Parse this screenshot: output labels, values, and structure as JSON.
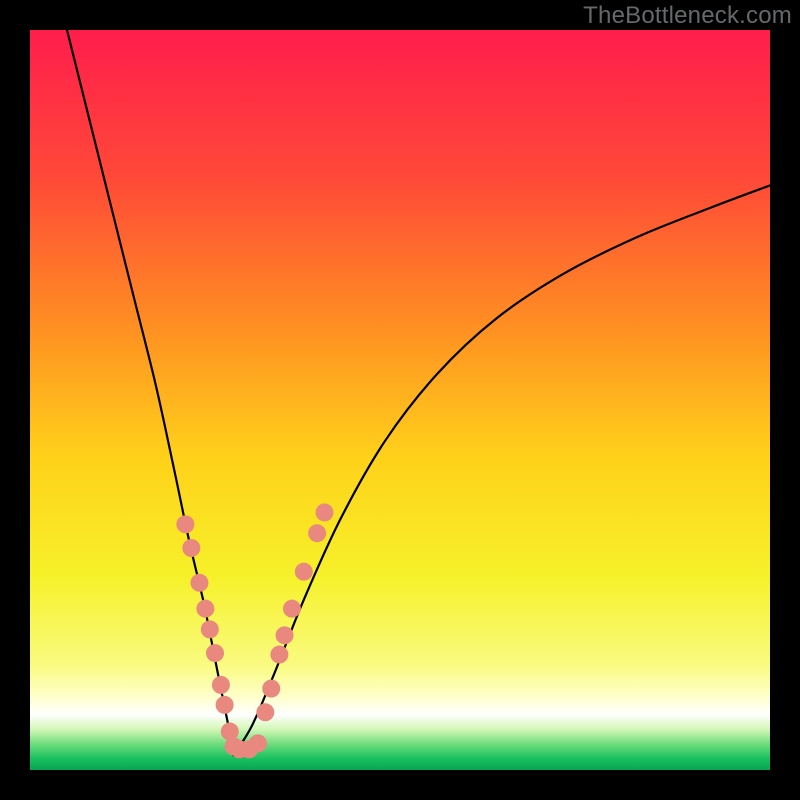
{
  "watermark": "TheBottleneck.com",
  "colors": {
    "bg": "#000000",
    "gradient_stops": [
      {
        "offset": 0.0,
        "color": "#ff1d4c"
      },
      {
        "offset": 0.2,
        "color": "#ff4938"
      },
      {
        "offset": 0.4,
        "color": "#ff8f22"
      },
      {
        "offset": 0.58,
        "color": "#ffd21a"
      },
      {
        "offset": 0.74,
        "color": "#f6f12a"
      },
      {
        "offset": 0.86,
        "color": "#f9fb82"
      },
      {
        "offset": 0.9,
        "color": "#ffffc9"
      },
      {
        "offset": 0.925,
        "color": "#ffffff"
      },
      {
        "offset": 0.945,
        "color": "#d2f7b6"
      },
      {
        "offset": 0.965,
        "color": "#6edc7d"
      },
      {
        "offset": 0.985,
        "color": "#18c060"
      },
      {
        "offset": 1.0,
        "color": "#0aa352"
      }
    ],
    "curve": "#000000",
    "marker": "#e8887f",
    "watermark": "#66696b"
  },
  "chart_data": {
    "type": "line",
    "title": "",
    "xlabel": "",
    "ylabel": "",
    "xlim": [
      0,
      1
    ],
    "ylim": [
      0,
      1
    ],
    "x_min_at": 0.275,
    "series": [
      {
        "name": "left-branch",
        "x": [
          0.05,
          0.08,
          0.11,
          0.14,
          0.17,
          0.195,
          0.215,
          0.235,
          0.25,
          0.262,
          0.272,
          0.275
        ],
        "y": [
          1.0,
          0.88,
          0.76,
          0.64,
          0.52,
          0.405,
          0.31,
          0.225,
          0.15,
          0.09,
          0.04,
          0.02
        ]
      },
      {
        "name": "right-branch",
        "x": [
          0.275,
          0.3,
          0.33,
          0.37,
          0.42,
          0.48,
          0.55,
          0.63,
          0.72,
          0.82,
          0.92,
          1.0
        ],
        "y": [
          0.02,
          0.06,
          0.13,
          0.23,
          0.34,
          0.445,
          0.535,
          0.61,
          0.67,
          0.72,
          0.76,
          0.79
        ]
      }
    ],
    "markers": {
      "name": "highlight-dots",
      "points": [
        {
          "x": 0.21,
          "y": 0.332
        },
        {
          "x": 0.218,
          "y": 0.3
        },
        {
          "x": 0.229,
          "y": 0.253
        },
        {
          "x": 0.237,
          "y": 0.218
        },
        {
          "x": 0.243,
          "y": 0.19
        },
        {
          "x": 0.25,
          "y": 0.158
        },
        {
          "x": 0.258,
          "y": 0.115
        },
        {
          "x": 0.263,
          "y": 0.088
        },
        {
          "x": 0.27,
          "y": 0.052
        },
        {
          "x": 0.275,
          "y": 0.032
        },
        {
          "x": 0.283,
          "y": 0.028
        },
        {
          "x": 0.296,
          "y": 0.028
        },
        {
          "x": 0.308,
          "y": 0.036
        },
        {
          "x": 0.318,
          "y": 0.078
        },
        {
          "x": 0.326,
          "y": 0.11
        },
        {
          "x": 0.337,
          "y": 0.156
        },
        {
          "x": 0.344,
          "y": 0.182
        },
        {
          "x": 0.354,
          "y": 0.218
        },
        {
          "x": 0.37,
          "y": 0.268
        },
        {
          "x": 0.388,
          "y": 0.32
        },
        {
          "x": 0.398,
          "y": 0.348
        }
      ]
    }
  }
}
